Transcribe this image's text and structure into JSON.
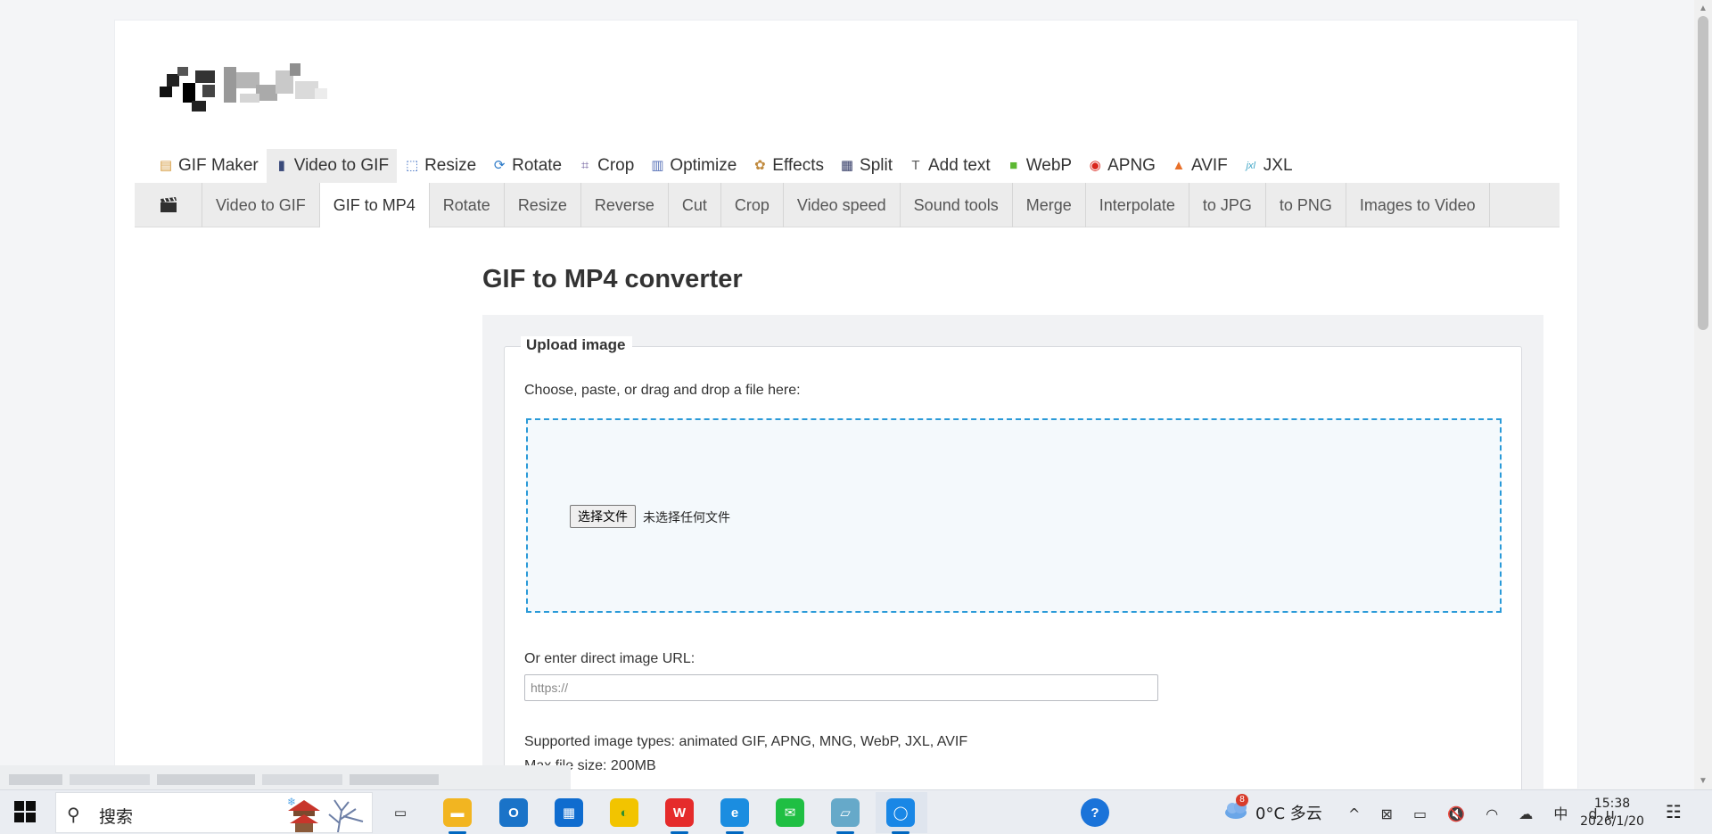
{
  "site": {
    "topnav": [
      {
        "label": "GIF Maker",
        "icon": "gif-maker-icon",
        "glyph": "▤",
        "color": "#d59a3c"
      },
      {
        "label": "Video to GIF",
        "icon": "film-icon",
        "glyph": "▮",
        "color": "#3a4a7a"
      },
      {
        "label": "Resize",
        "icon": "resize-icon",
        "glyph": "⬚",
        "color": "#3f6fc2"
      },
      {
        "label": "Rotate",
        "icon": "rotate-icon",
        "glyph": "⟳",
        "color": "#2f7cc9"
      },
      {
        "label": "Crop",
        "icon": "crop-icon",
        "glyph": "⌗",
        "color": "#6b5b9b"
      },
      {
        "label": "Optimize",
        "icon": "optimize-icon",
        "glyph": "▥",
        "color": "#5872b8"
      },
      {
        "label": "Effects",
        "icon": "effects-icon",
        "glyph": "✿",
        "color": "#c08a3e"
      },
      {
        "label": "Split",
        "icon": "split-icon",
        "glyph": "▦",
        "color": "#333b66"
      },
      {
        "label": "Add text",
        "icon": "add-text-icon",
        "glyph": "T",
        "color": "#555555"
      },
      {
        "label": "WebP",
        "icon": "webp-icon",
        "glyph": "■",
        "color": "#5cb832"
      },
      {
        "label": "APNG",
        "icon": "apng-icon",
        "glyph": "◉",
        "color": "#d9261c"
      },
      {
        "label": "AVIF",
        "icon": "avif-icon",
        "glyph": "▲",
        "color": "#e8702a"
      },
      {
        "label": "JXL",
        "icon": "jxl-icon",
        "glyph": "jxl",
        "color": "#3fa6c6"
      }
    ],
    "topnav_active": 1,
    "subnav": [
      "Video to GIF",
      "GIF to MP4",
      "Rotate",
      "Resize",
      "Reverse",
      "Cut",
      "Crop",
      "Video speed",
      "Sound tools",
      "Merge",
      "Interpolate",
      "to JPG",
      "to PNG",
      "Images to Video"
    ],
    "subnav_active": 1,
    "subnav_icon": "clapperboard-icon"
  },
  "main": {
    "title": "GIF to MP4 converter",
    "upload": {
      "legend": "Upload image",
      "choose_label": "Choose, paste, or drag and drop a file here:",
      "file_button": "选择文件",
      "file_status": "未选择任何文件",
      "url_label": "Or enter direct image URL:",
      "url_placeholder": "https://",
      "supported": "Supported image types: animated GIF, APNG, MNG, WebP, JXL, AVIF",
      "max_size": "Max file size: 200MB"
    }
  },
  "taskbar": {
    "search_placeholder": "搜索",
    "weather_badge": "8",
    "weather_text": "0°C  多云",
    "time": "15:38",
    "date": "2026/1/20",
    "apps": [
      {
        "name": "task-view-icon",
        "label": "▭",
        "bg": "#eaedf2",
        "fg": "#222"
      },
      {
        "name": "file-explorer-icon",
        "label": "▬",
        "bg": "#f2b521",
        "fg": "#fff"
      },
      {
        "name": "outlook-icon",
        "label": "O",
        "bg": "#1a73c8",
        "fg": "#fff"
      },
      {
        "name": "store-icon",
        "label": "▦",
        "bg": "#0f6ccf",
        "fg": "#fff"
      },
      {
        "name": "app-circle-icon",
        "label": "◐",
        "bg": "#f2c400",
        "fg": "#2f8f2f"
      },
      {
        "name": "wps-icon",
        "label": "W",
        "bg": "#e52b2b",
        "fg": "#fff"
      },
      {
        "name": "edge-icon",
        "label": "e",
        "bg": "#1b8de0",
        "fg": "#fff"
      },
      {
        "name": "wechat-icon",
        "label": "✉",
        "bg": "#1fbf43",
        "fg": "#fff"
      },
      {
        "name": "notepad-icon",
        "label": "▱",
        "bg": "#66a9c9",
        "fg": "#fff"
      },
      {
        "name": "browser-icon",
        "label": "◯",
        "bg": "#1987e6",
        "fg": "#fff"
      },
      {
        "name": "help-icon",
        "label": "?",
        "bg": "#1a73d9",
        "fg": "#fff"
      }
    ],
    "tray_glyphs": "^ ⊠ ▭ 🔇 ◠ ☁ 中 du",
    "notification_glyph": "☷"
  },
  "colors": {
    "accent": "#2a9ad8",
    "nav_bg": "#ececec",
    "panel_bg": "#f1f2f4"
  }
}
